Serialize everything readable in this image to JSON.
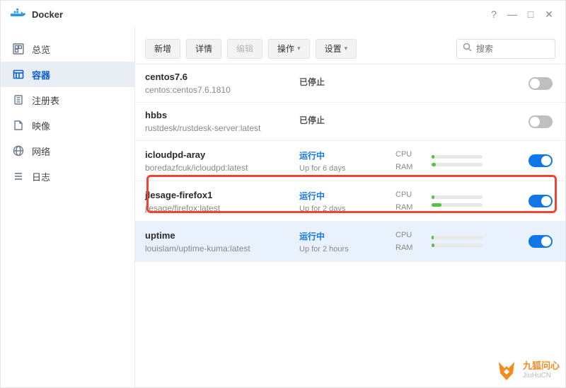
{
  "window": {
    "title": "Docker"
  },
  "sidebar": {
    "items": [
      {
        "key": "overview",
        "label": "总览"
      },
      {
        "key": "container",
        "label": "容器"
      },
      {
        "key": "registry",
        "label": "注册表"
      },
      {
        "key": "image",
        "label": "映像"
      },
      {
        "key": "network",
        "label": "网络"
      },
      {
        "key": "log",
        "label": "日志"
      }
    ],
    "active": "container"
  },
  "toolbar": {
    "new": "新增",
    "detail": "详情",
    "edit": "编辑",
    "action": "操作",
    "settings": "设置"
  },
  "search": {
    "placeholder": "搜索"
  },
  "status_text": {
    "stopped": "已停止",
    "running": "运行中"
  },
  "metrics": {
    "cpu": "CPU",
    "ram": "RAM"
  },
  "containers": [
    {
      "name": "centos7.6",
      "image": "centos:centos7.6.1810",
      "state": "stopped",
      "uptime": "",
      "cpu": 0,
      "ram": 0,
      "on": false,
      "selected": false
    },
    {
      "name": "hbbs",
      "image": "rustdesk/rustdesk-server:latest",
      "state": "stopped",
      "uptime": "",
      "cpu": 0,
      "ram": 0,
      "on": false,
      "selected": false
    },
    {
      "name": "icloudpd-aray",
      "image": "boredazfcuk/icloudpd:latest",
      "state": "running",
      "uptime": "Up for 6 days",
      "cpu": 6,
      "ram": 8,
      "on": true,
      "selected": false
    },
    {
      "name": "jlesage-firefox1",
      "image": "jlesage/firefox:latest",
      "state": "running",
      "uptime": "Up for 2 days",
      "cpu": 5,
      "ram": 20,
      "on": true,
      "selected": false
    },
    {
      "name": "uptime",
      "image": "louislam/uptime-kuma:latest",
      "state": "running",
      "uptime": "Up for 2 hours",
      "cpu": 4,
      "ram": 6,
      "on": true,
      "selected": true
    }
  ],
  "watermark": {
    "cn": "九狐问心",
    "en": "JiuHuCN"
  }
}
